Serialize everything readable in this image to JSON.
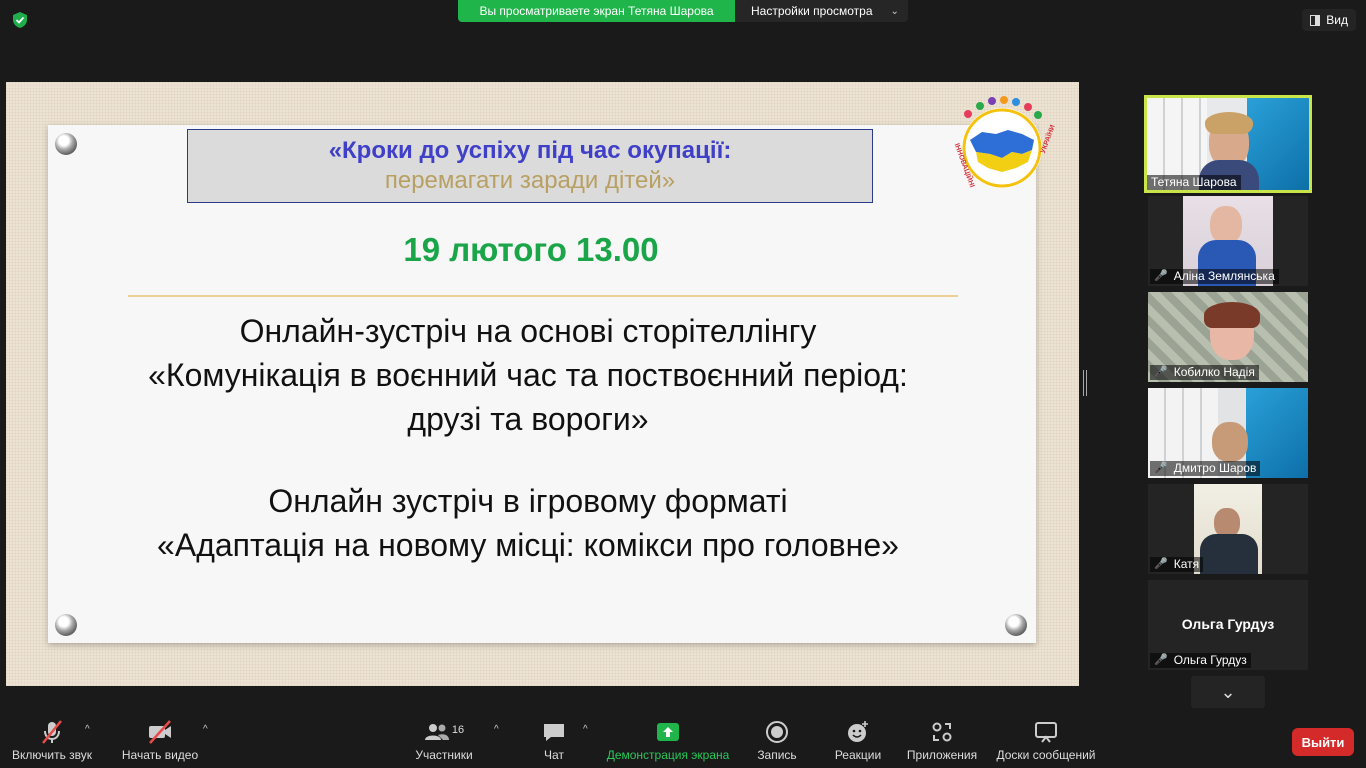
{
  "top": {
    "share_text": "Вы просматриваете экран Тетяна Шарова",
    "view_settings": "Настройки просмотра",
    "view_button": "Вид"
  },
  "slide": {
    "title_line1": "«Кроки до успіху під час окупації:",
    "title_line2": "перемагати заради дітей»",
    "date": "19 лютого 13.00",
    "block1_line1": "Онлайн-зустріч на основі сторітеллінгу",
    "block1_line2": "«Комунікація в воєнний час та поствоєнний період:",
    "block1_line3": "друзі та вороги»",
    "block2_line1": "Онлайн зустріч в ігровому форматі",
    "block2_line2": "«Адаптація на новому місці: комікси про головне»",
    "logo_text": "ІННОВАЦІЙНІ ОБРІЇ УКРАЇНИ"
  },
  "participants": [
    {
      "name": "Тетяна Шарова",
      "muted": false,
      "active": true
    },
    {
      "name": "Аліна Землянська",
      "muted": true
    },
    {
      "name": "Кобилко Надія",
      "muted": true
    },
    {
      "name": "Дмитро Шаров",
      "muted": true
    },
    {
      "name": "Катя",
      "muted": true
    },
    {
      "name": "Ольга Гурдуз",
      "muted": true,
      "display_name": "Ольга Гурдуз"
    }
  ],
  "toolbar": {
    "audio": "Включить звук",
    "video": "Начать видео",
    "participants": "Участники",
    "participants_count": "16",
    "chat": "Чат",
    "share": "Демонстрация экрана",
    "record": "Запись",
    "reactions": "Реакции",
    "apps": "Приложения",
    "whiteboards": "Доски сообщений",
    "exit": "Выйти"
  },
  "colors": {
    "share_green": "#20b54a",
    "date_green": "#1aa548",
    "active_border": "#c8e64a",
    "exit_red": "#d42a2a"
  }
}
